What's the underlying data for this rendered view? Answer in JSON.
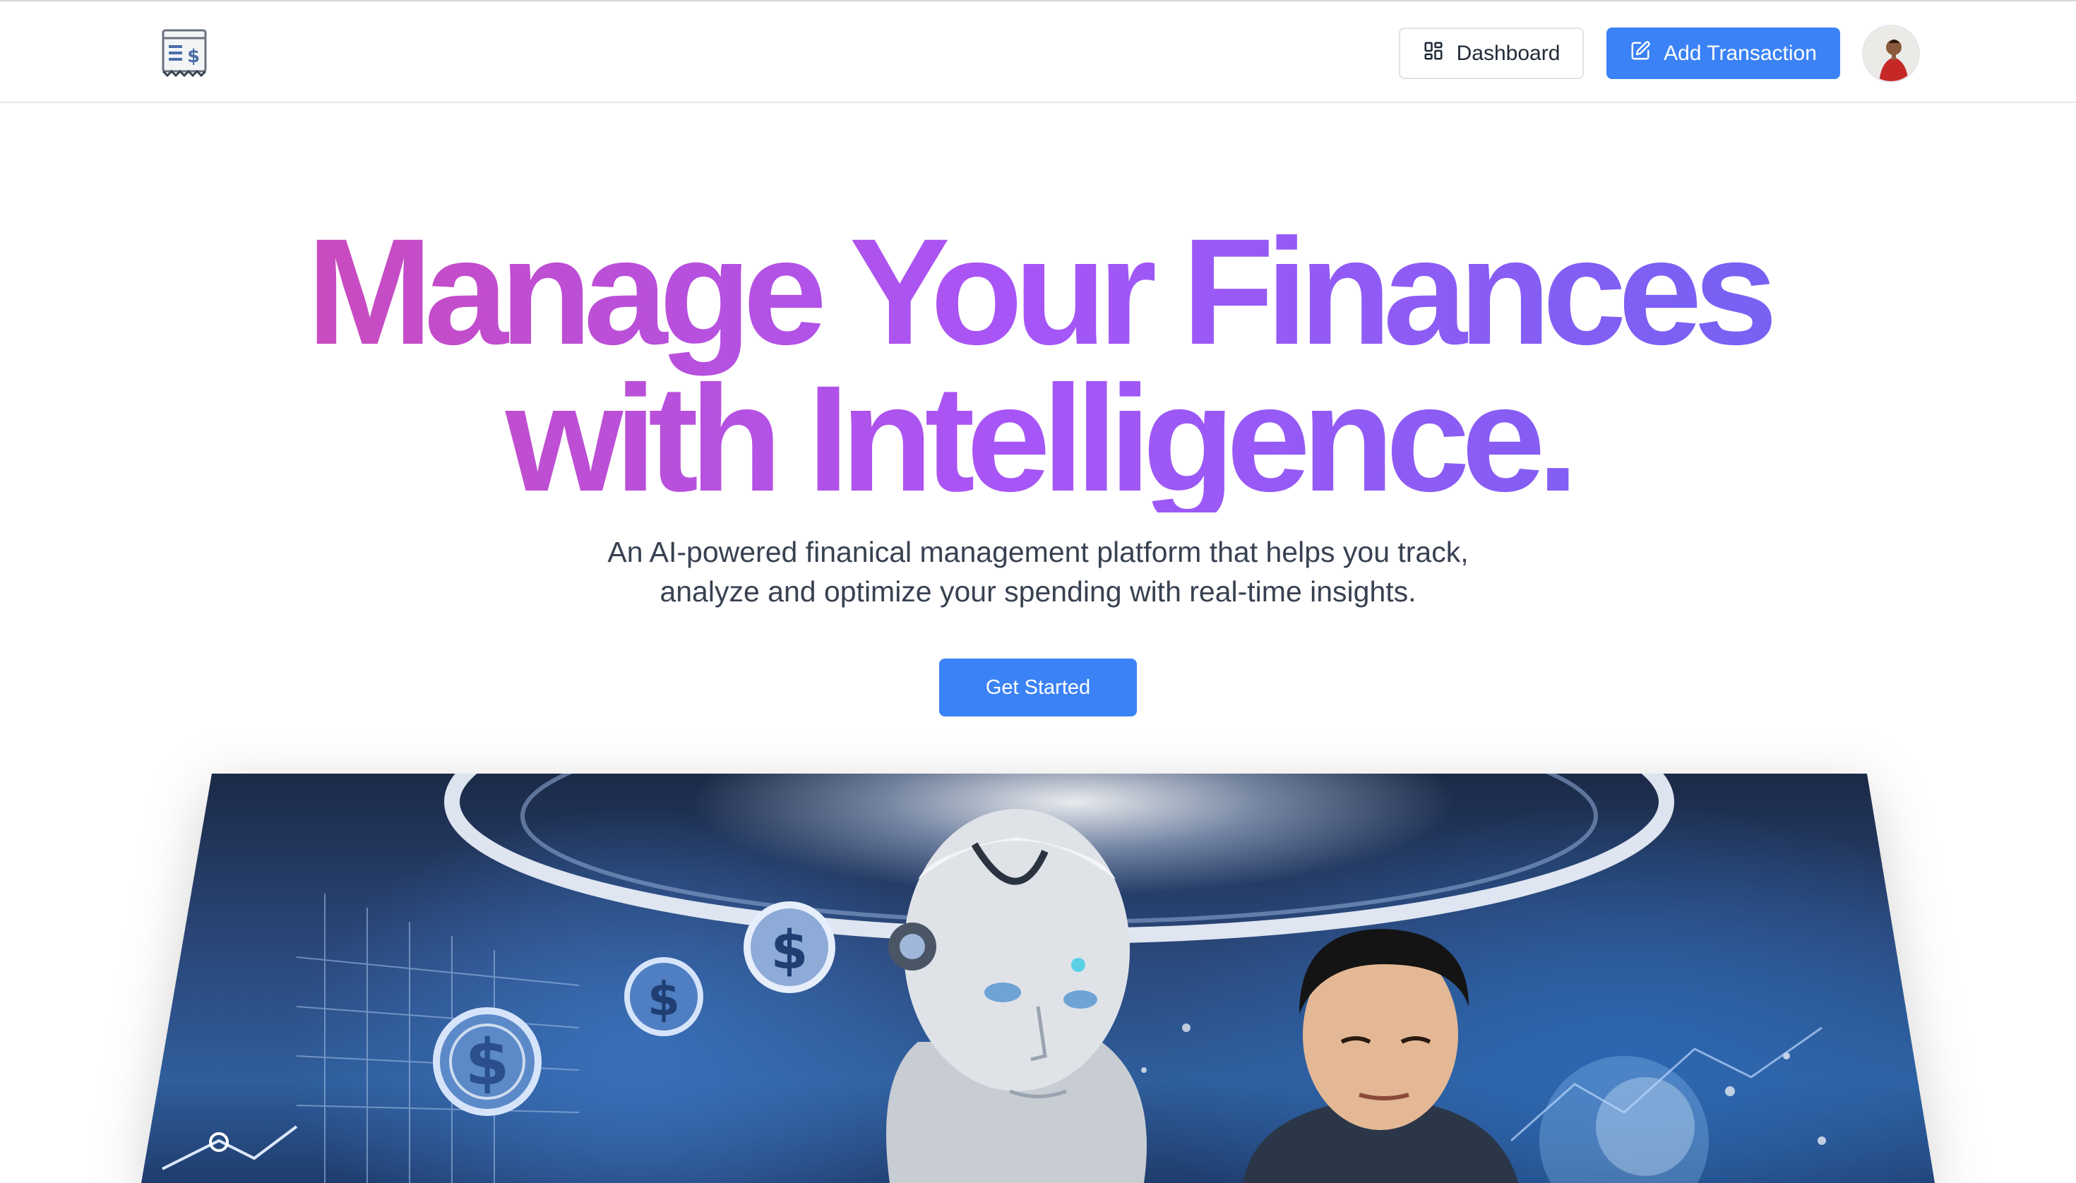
{
  "header": {
    "logo_icon": "receipt-dollar-icon",
    "dashboard_label": "Dashboard",
    "dashboard_icon": "layout-grid-icon",
    "add_transaction_label": "Add Transaction",
    "add_transaction_icon": "pen-square-icon",
    "avatar_icon": "user-avatar"
  },
  "hero": {
    "title_line1": "Manage Your Finances",
    "title_line2": "with Intelligence.",
    "subtitle_line1": "An AI-powered finanical management platform that helps you track,",
    "subtitle_line2": "analyze and optimize your spending with real-time insights.",
    "cta_label": "Get Started"
  },
  "banner": {
    "image_description": "hero-banner-image"
  },
  "colors": {
    "primary": "#3b82f6",
    "gradient_start": "#d946a6",
    "gradient_mid": "#a855f7",
    "gradient_end": "#6366f1",
    "text_muted": "#374151"
  }
}
